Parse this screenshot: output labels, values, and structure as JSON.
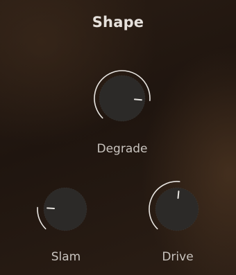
{
  "panel": {
    "title": "Shape"
  },
  "knobs": [
    {
      "id": "degrade",
      "label": "Degrade",
      "value": 0.85
    },
    {
      "id": "slam",
      "label": "Slam",
      "value": 0.18
    },
    {
      "id": "drive",
      "label": "Drive",
      "value": 0.52
    }
  ],
  "colors": {
    "arc": "#e9e6e2",
    "knob_face": "#2c2a28",
    "indicator": "#e9e6e2",
    "label": "#c9c4bf",
    "title": "#e6e1dc"
  }
}
